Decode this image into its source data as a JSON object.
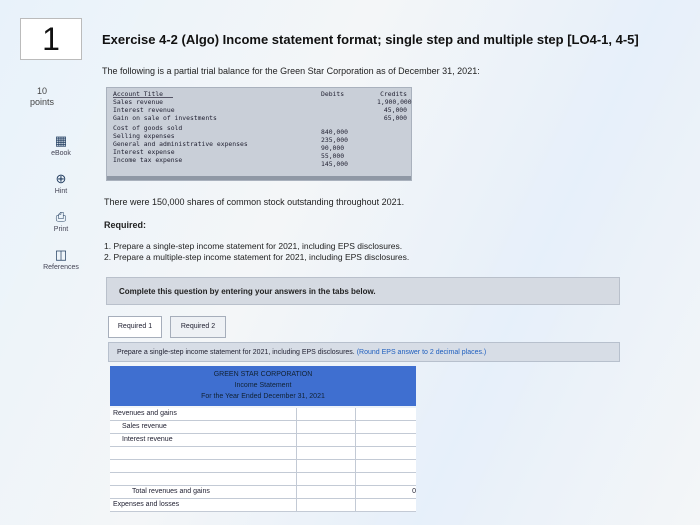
{
  "question": {
    "number": "1",
    "points_value": "10",
    "points_label": "points"
  },
  "tools": [
    {
      "label": "eBook",
      "icon": "book-icon"
    },
    {
      "label": "Hint",
      "icon": "globe-icon"
    },
    {
      "label": "Print",
      "icon": "printer-icon"
    },
    {
      "label": "References",
      "icon": "references-icon"
    }
  ],
  "exercise": {
    "title": "Exercise 4-2 (Algo) Income statement format; single step and multiple step [LO4-1, 4-5]",
    "intro": "The following is a partial trial balance for the Green Star Corporation as of December 31, 2021:"
  },
  "trial_balance": {
    "headers": {
      "account": "Account Title",
      "debits": "Debits",
      "credits": "Credits"
    },
    "rows": [
      {
        "account": "Sales revenue",
        "debit": "",
        "credit": "1,900,000"
      },
      {
        "account": "Interest revenue",
        "debit": "",
        "credit": "45,000"
      },
      {
        "account": "Gain on sale of investments",
        "debit": "",
        "credit": "65,000"
      },
      {
        "account": "Cost of goods sold",
        "debit": "840,000",
        "credit": ""
      },
      {
        "account": "Selling expenses",
        "debit": "235,000",
        "credit": ""
      },
      {
        "account": "General and administrative expenses",
        "debit": "90,000",
        "credit": ""
      },
      {
        "account": "Interest expense",
        "debit": "55,000",
        "credit": ""
      },
      {
        "account": "Income tax expense",
        "debit": "145,000",
        "credit": ""
      }
    ]
  },
  "shares_text": "There were 150,000 shares of common stock outstanding throughout 2021.",
  "required": {
    "heading": "Required:",
    "items": [
      "1. Prepare a single-step income statement for 2021, including EPS disclosures.",
      "2. Prepare a multiple-step income statement for 2021, including EPS disclosures."
    ]
  },
  "complete_banner": "Complete this question by entering your answers in the tabs below.",
  "tabs": [
    {
      "label": "Required 1",
      "active": true
    },
    {
      "label": "Required 2",
      "active": false
    }
  ],
  "instructions": {
    "main": "Prepare a single-step income statement for 2021, including EPS disclosures.",
    "note": "(Round EPS answer to 2 decimal places.)"
  },
  "statement": {
    "company": "GREEN STAR CORPORATION",
    "name": "Income Statement",
    "period": "For the Year Ended December 31, 2021",
    "rows": [
      {
        "label": "Revenues and gains",
        "type": "section",
        "value": ""
      },
      {
        "label": "Sales revenue",
        "type": "sub",
        "value": ""
      },
      {
        "label": "Interest revenue",
        "type": "sub",
        "value": ""
      },
      {
        "label": "",
        "type": "input",
        "value": ""
      },
      {
        "label": "",
        "type": "input",
        "value": ""
      },
      {
        "label": "",
        "type": "input",
        "value": ""
      },
      {
        "label": "Total revenues and gains",
        "type": "total",
        "value": "0"
      },
      {
        "label": "Expenses and losses",
        "type": "section",
        "value": ""
      }
    ]
  }
}
